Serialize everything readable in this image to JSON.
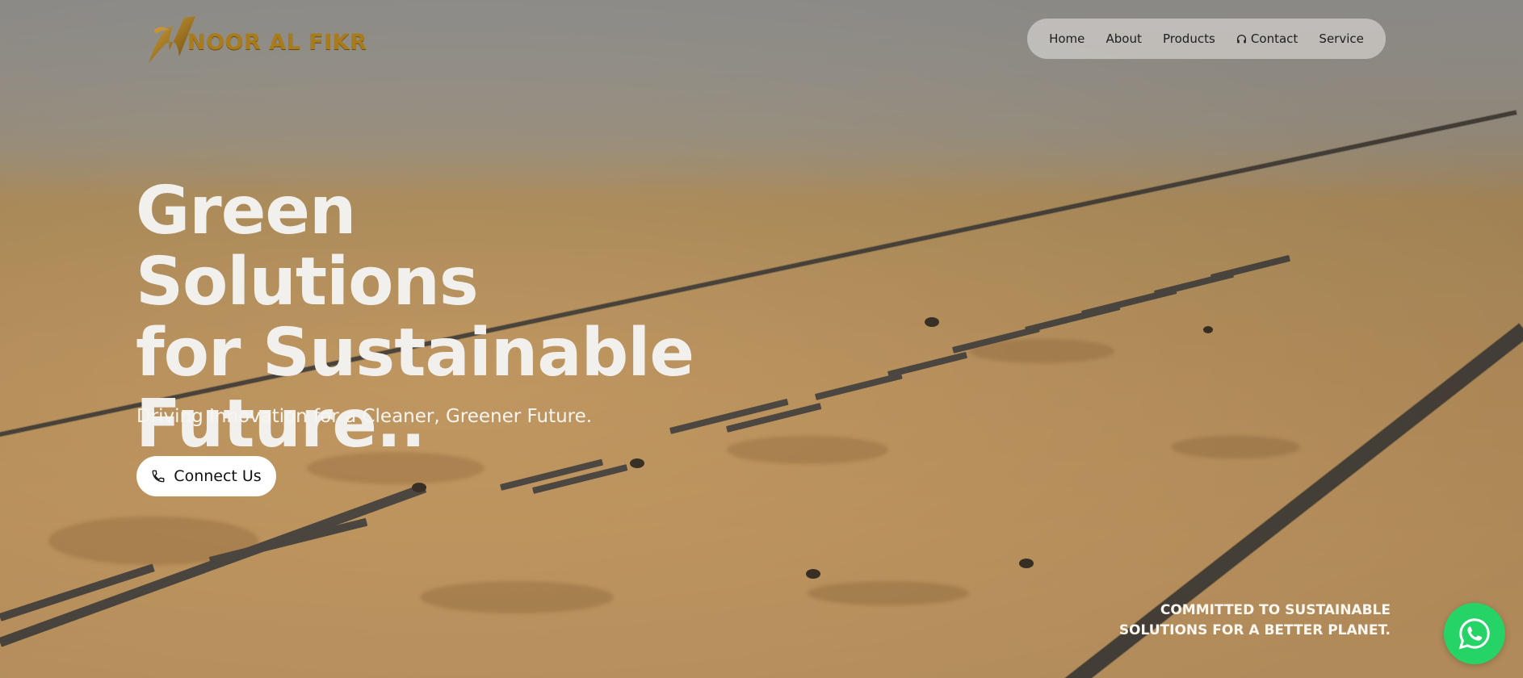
{
  "brand": {
    "name": "NOOR AL FIKR",
    "logo_icon": "n-bird-logo-icon",
    "color": "#a87c1c"
  },
  "nav": {
    "items": [
      {
        "label": "Home"
      },
      {
        "label": "About"
      },
      {
        "label": "Products"
      },
      {
        "label": "Contact",
        "icon": "headset-icon"
      },
      {
        "label": "Service"
      }
    ]
  },
  "hero": {
    "title_lines": [
      "Green Solutions",
      "for Sustainable",
      "Future.."
    ],
    "subtitle": "Driving Innovation for a Cleaner, Greener Future.",
    "cta_label": "Connect Us",
    "cta_icon": "phone-icon"
  },
  "tagline": {
    "lines": [
      "COMMITTED TO SUSTAINABLE",
      "SOLUTIONS FOR A BETTER PLANET."
    ]
  },
  "whatsapp": {
    "icon": "whatsapp-icon",
    "color": "#25d366"
  },
  "colors": {
    "sand": "#c69b63",
    "haze": "#9c9a96",
    "title_text": "#f2f0ec"
  }
}
